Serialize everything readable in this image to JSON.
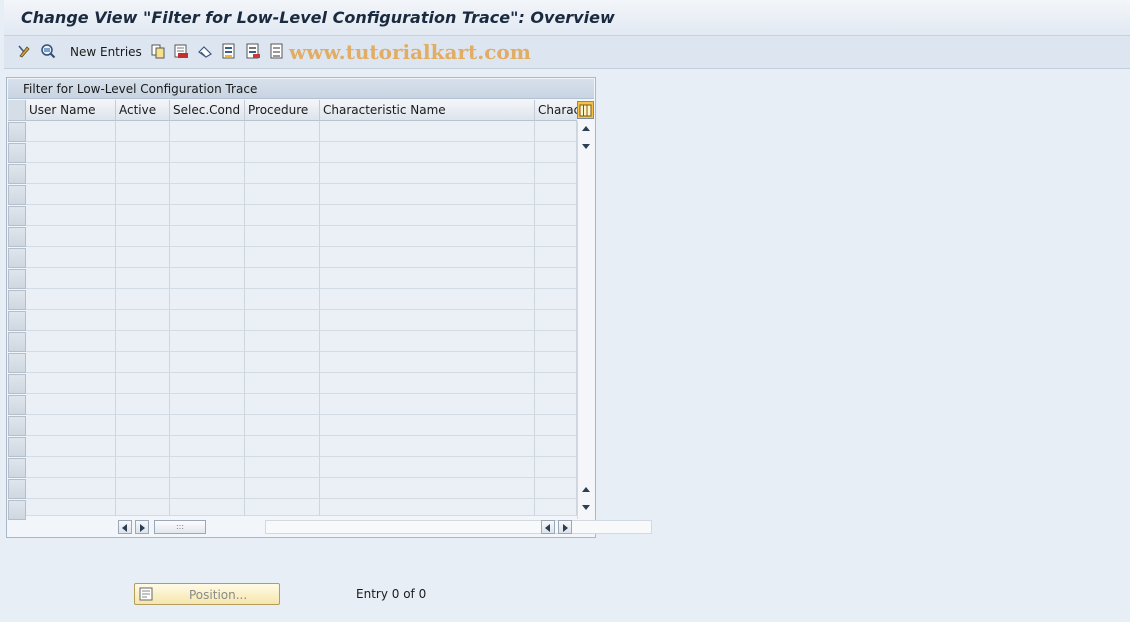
{
  "window": {
    "title": "Change View \"Filter for Low-Level Configuration Trace\": Overview"
  },
  "toolbar": {
    "new_entries_label": "New Entries",
    "watermark": "www.tutorialkart.com",
    "icons": [
      "display-change-icon",
      "details-icon",
      "copy-icon",
      "delete-icon",
      "undo-icon",
      "select-all-icon",
      "select-block-icon",
      "deselect-all-icon"
    ]
  },
  "table": {
    "title": "Filter for Low-Level Configuration Trace",
    "columns": [
      "User Name",
      "Active",
      "Selec.Cond",
      "Procedure",
      "Characteristic Name",
      "Charact"
    ],
    "rows": []
  },
  "footer": {
    "position_label": "Position...",
    "entry_text": "Entry 0 of 0"
  },
  "colors": {
    "background": "#e8eef6",
    "cell": "#ebf0f6",
    "button_accent": "#f5e6ad"
  }
}
